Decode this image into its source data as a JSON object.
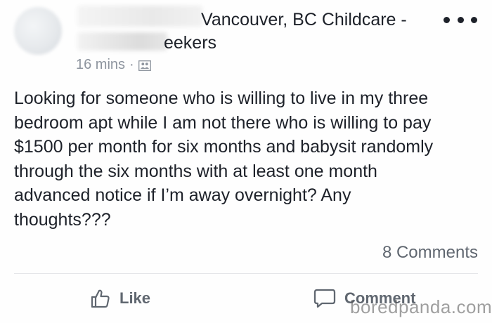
{
  "post": {
    "group_title_line1": "Vancouver, BC Childcare -",
    "group_title_line2": "eekers",
    "timestamp": "16 mins",
    "meta_separator": "·",
    "body": "Looking for someone who is willing to live in my three\nbedroom apt while I am not there who is willing to pay\n$1500 per month for six months and babysit randomly\nthrough the six months with at least one month\nadvanced notice if I’m away overnight? Any\nthoughts???",
    "comments_count": "8 Comments"
  },
  "actions": {
    "like_label": "Like",
    "comment_label": "Comment"
  },
  "icons": {
    "more": "more-options-icon",
    "audience": "group-members-icon",
    "like": "thumbs-up-icon",
    "comment": "speech-bubble-icon"
  },
  "watermark": "boredpanda.com",
  "colors": {
    "text_primary": "#1d2129",
    "text_secondary": "#606770",
    "meta": "#8d949e"
  }
}
